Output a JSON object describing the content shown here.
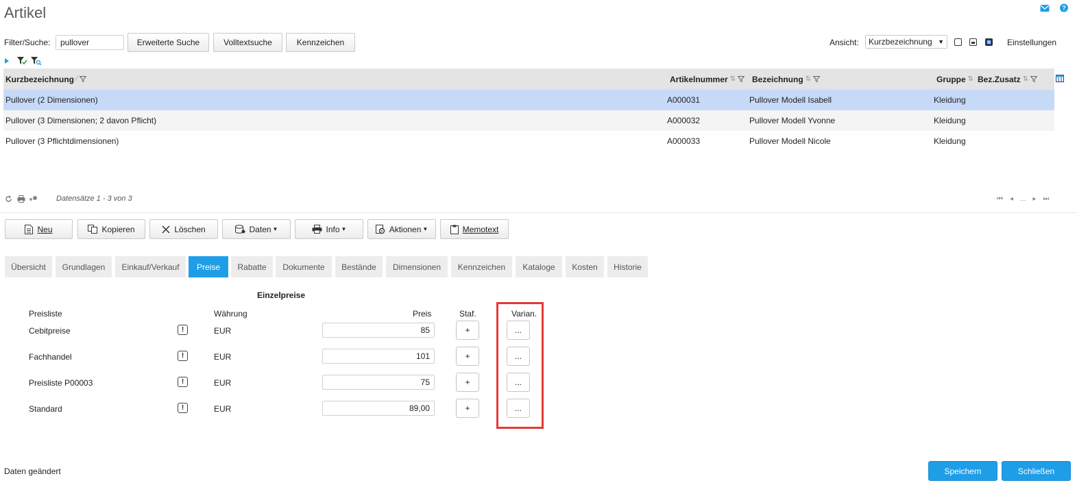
{
  "header": {
    "title": "Artikel"
  },
  "colors": {
    "accent": "#1f9ee8",
    "selected_row": "#c6daf8",
    "highlight": "#e53935"
  },
  "filter": {
    "label": "Filter/Suche:",
    "value": "pullover",
    "buttons": {
      "extended": "Erweiterte Suche",
      "fulltext": "Volltextsuche",
      "flags": "Kennzeichen"
    }
  },
  "view": {
    "label": "Ansicht:",
    "selected": "Kurzbezeichnung",
    "settings_label": "Einstellungen"
  },
  "grid": {
    "columns": {
      "short_desc": "Kurzbezeichnung",
      "article_no": "Artikelnummer",
      "description": "Bezeichnung",
      "group": "Gruppe",
      "extra": "Bez.Zusatz"
    },
    "rows": [
      {
        "short_desc": "Pullover (2 Dimensionen)",
        "article_no": "A000031",
        "description": "Pullover Modell Isabell",
        "group": "Kleidung",
        "extra": ""
      },
      {
        "short_desc": "Pullover (3 Dimensionen; 2 davon Pflicht)",
        "article_no": "A000032",
        "description": "Pullover Modell Yvonne",
        "group": "Kleidung",
        "extra": ""
      },
      {
        "short_desc": "Pullover (3 Pflichtdimensionen)",
        "article_no": "A000033",
        "description": "Pullover Modell Nicole",
        "group": "Kleidung",
        "extra": ""
      }
    ],
    "record_info": "Datensätze 1 - 3 von 3",
    "pager_ellipsis": "..."
  },
  "toolbar": {
    "new": "Neu",
    "copy": "Kopieren",
    "delete": "Löschen",
    "data": "Daten",
    "info": "Info",
    "actions": "Aktionen",
    "memo": "Memotext"
  },
  "tabs": [
    "Übersicht",
    "Grundlagen",
    "Einkauf/Verkauf",
    "Preise",
    "Rabatte",
    "Dokumente",
    "Bestände",
    "Dimensionen",
    "Kennzeichen",
    "Kataloge",
    "Kosten",
    "Historie"
  ],
  "active_tab": "Preise",
  "prices": {
    "section_title": "Einzelpreise",
    "headers": {
      "pricelist": "Preisliste",
      "currency": "Währung",
      "price": "Preis",
      "staf": "Staf.",
      "variants": "Varian."
    },
    "rows": [
      {
        "pricelist": "Cebitpreise",
        "currency": "EUR",
        "price": "85"
      },
      {
        "pricelist": "Fachhandel",
        "currency": "EUR",
        "price": "101"
      },
      {
        "pricelist": "Preisliste P00003",
        "currency": "EUR",
        "price": "75"
      },
      {
        "pricelist": "Standard",
        "currency": "EUR",
        "price": "89,00"
      }
    ],
    "exclamation": "!",
    "staf_button": "+",
    "variant_button": "..."
  },
  "footer": {
    "status": "Daten geändert",
    "save": "Speichern",
    "close": "Schließen"
  }
}
